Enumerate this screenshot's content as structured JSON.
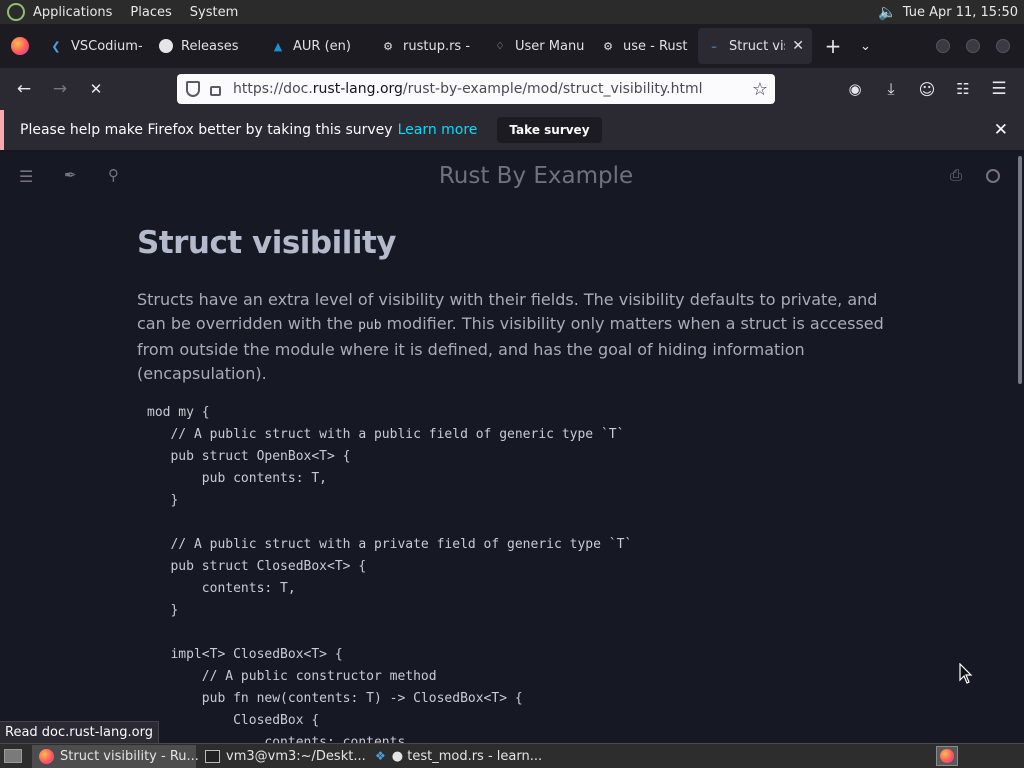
{
  "panel": {
    "menus": [
      "Applications",
      "Places",
      "System"
    ],
    "clock": "Tue Apr 11, 15:50"
  },
  "tabs": [
    {
      "label": "VSCodium-",
      "icon": "vscodium-icon"
    },
    {
      "label": "Releases",
      "icon": "github-icon"
    },
    {
      "label": "AUR (en)",
      "icon": "archlinux-icon"
    },
    {
      "label": "rustup.rs -",
      "icon": "rust-icon"
    },
    {
      "label": "User Manu",
      "icon": "manual-icon"
    },
    {
      "label": "use - Rust",
      "icon": "rust-icon"
    },
    {
      "label": "Struct vis",
      "icon": "loading-icon"
    }
  ],
  "navbar": {
    "url_prefix": "https://doc.",
    "url_domain": "rust-lang.org",
    "url_suffix": "/rust-by-example/mod/struct_visibility.html"
  },
  "notification": {
    "message": "Please help make Firefox better by taking this survey",
    "link": "Learn more",
    "button": "Take survey"
  },
  "page": {
    "book_title": "Rust By Example",
    "heading": "Struct visibility",
    "intro_before": "Structs have an extra level of visibility with their fields. The visibility defaults to private, and can be overridden with the ",
    "intro_code": "pub",
    "intro_after": " modifier. This visibility only matters when a struct is accessed from outside the module where it is defined, and has the goal of hiding information (encapsulation).",
    "code": "mod my {\n   // A public struct with a public field of generic type `T`\n   pub struct OpenBox<T> {\n       pub contents: T,\n   }\n\n   // A public struct with a private field of generic type `T`\n   pub struct ClosedBox<T> {\n       contents: T,\n   }\n\n   impl<T> ClosedBox<T> {\n       // A public constructor method\n       pub fn new(contents: T) -> ClosedBox<T> {\n           ClosedBox {\n               contents: contents,\n           }"
  },
  "status_text": "Read doc.rust-lang.org",
  "taskbar": {
    "items": [
      "Struct visibility - Ru...",
      "vm3@vm3:~/Deskt...",
      "● test_mod.rs - learn..."
    ]
  }
}
